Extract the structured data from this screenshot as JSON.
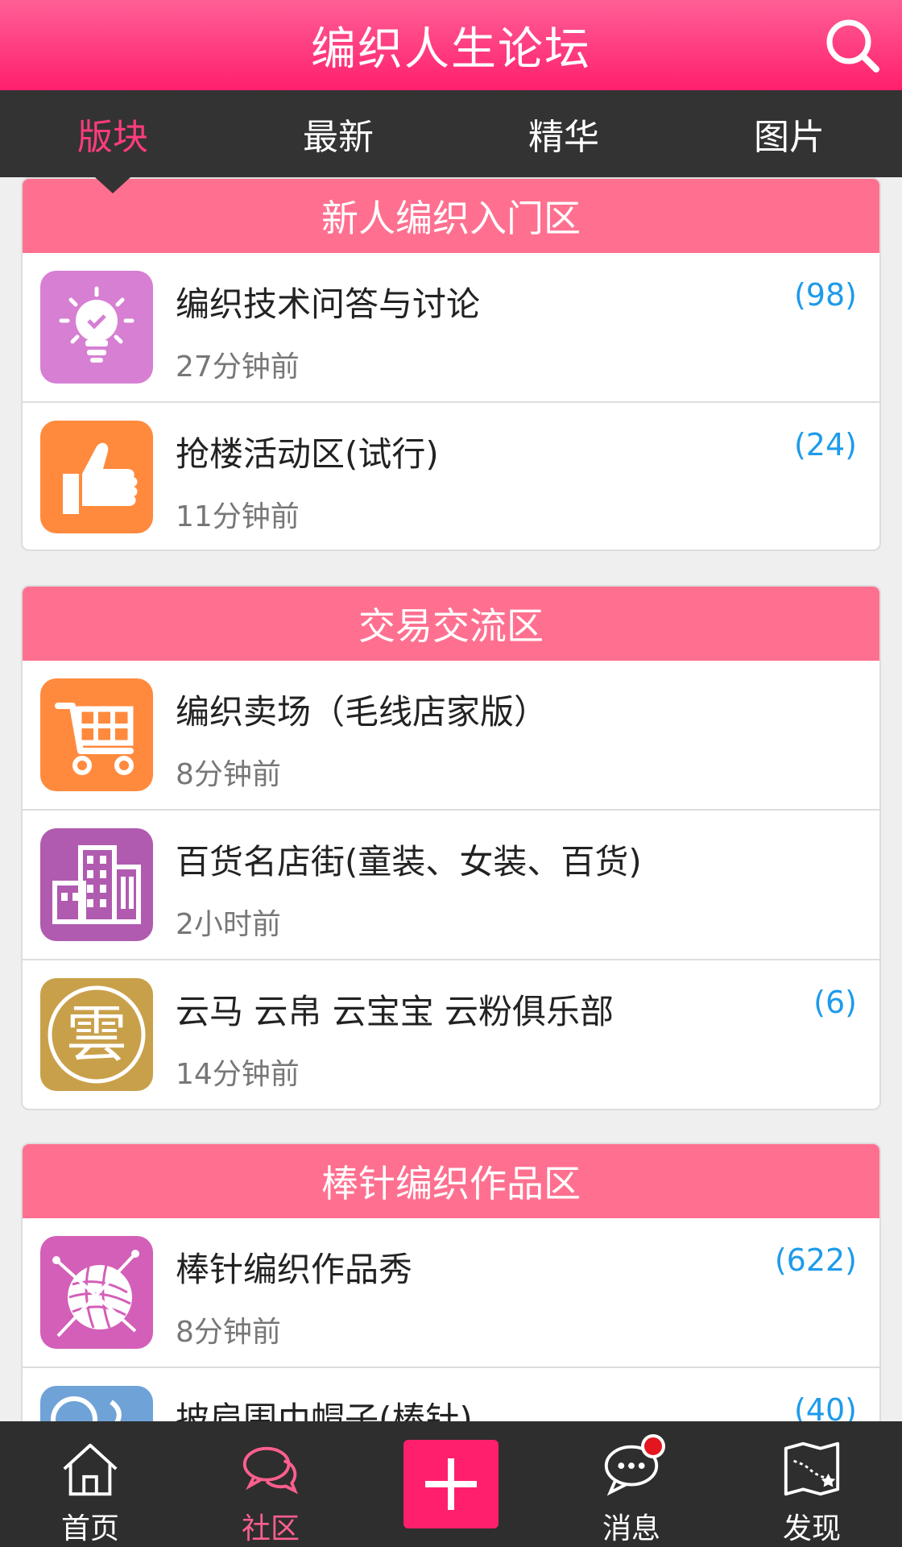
{
  "header": {
    "title": "编织人生论坛",
    "search_icon": "search-icon"
  },
  "tabs": [
    {
      "label": "版块",
      "active": true
    },
    {
      "label": "最新",
      "active": false
    },
    {
      "label": "精华",
      "active": false
    },
    {
      "label": "图片",
      "active": false
    }
  ],
  "sections": [
    {
      "title": "新人编织入门区",
      "forums": [
        {
          "title": "编织技术问答与讨论",
          "time": "27分钟前",
          "count": "(98)",
          "icon": "lightbulb-icon",
          "icon_color": "#d67fd3"
        },
        {
          "title": "抢楼活动区(试行)",
          "time": "11分钟前",
          "count": "(24)",
          "icon": "thumbs-up-icon",
          "icon_color": "#ff8a3d"
        }
      ]
    },
    {
      "title": "交易交流区",
      "forums": [
        {
          "title": "编织卖场（毛线店家版）",
          "time": "8分钟前",
          "count": "",
          "icon": "shopping-cart-icon",
          "icon_color": "#ff8a3d"
        },
        {
          "title": "百货名店街(童装、女装、百货)",
          "time": "2小时前",
          "count": "",
          "icon": "building-icon",
          "icon_color": "#b05bb0"
        },
        {
          "title": "云马 云帛 云宝宝 云粉俱乐部",
          "time": "14分钟前",
          "count": "(6)",
          "icon": "yun-logo-icon",
          "icon_color": "#c9a04a"
        }
      ]
    },
    {
      "title": "棒针编织作品区",
      "forums": [
        {
          "title": "棒针编织作品秀",
          "time": "8分钟前",
          "count": "(622)",
          "icon": "yarn-ball-icon",
          "icon_color": "#d35fb8"
        },
        {
          "title": "披肩围巾帽子(棒针)",
          "time": "",
          "count": "(40)",
          "icon": "scarf-icon",
          "icon_color": "#6fa3d8"
        }
      ]
    }
  ],
  "bottom_nav": [
    {
      "label": "首页",
      "icon": "home-icon",
      "active": false
    },
    {
      "label": "社区",
      "icon": "chat-bubbles-icon",
      "active": true
    },
    {
      "label": "",
      "icon": "plus-icon",
      "active": false
    },
    {
      "label": "消息",
      "icon": "message-icon",
      "active": false,
      "badge": true
    },
    {
      "label": "发现",
      "icon": "map-icon",
      "active": false
    }
  ],
  "colors": {
    "header": "#ff1f6d",
    "section_header": "#ff7090",
    "count": "#1e9bea",
    "active_tab": "#ff3c7d"
  }
}
